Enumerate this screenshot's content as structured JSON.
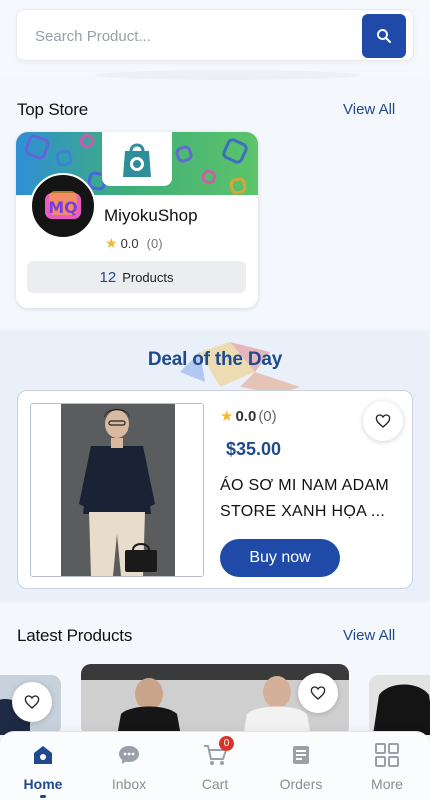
{
  "search": {
    "placeholder": "Search Product..."
  },
  "top_store": {
    "title": "Top Store",
    "view_all": "View All",
    "store": {
      "name": "MiyokuShop",
      "rating": "0.0",
      "review_count": "(0)",
      "product_count": "12",
      "products_label": "Products",
      "avatar_letters": "MQ"
    }
  },
  "deal": {
    "title": "Deal of the Day",
    "rating": "0.0",
    "review_count": "(0)",
    "price": "$35.00",
    "name": "ÁO SƠ MI NAM ADAM STORE XANH HỌA ...",
    "buy_label": "Buy now"
  },
  "latest": {
    "title": "Latest Products",
    "view_all": "View All"
  },
  "nav": {
    "items": [
      {
        "label": "Home",
        "icon": "home-icon",
        "active": true
      },
      {
        "label": "Inbox",
        "icon": "chat-icon"
      },
      {
        "label": "Cart",
        "icon": "cart-icon",
        "badge": "0"
      },
      {
        "label": "Orders",
        "icon": "orders-icon"
      },
      {
        "label": "More",
        "icon": "grid-icon"
      }
    ]
  },
  "colors": {
    "brand": "#1f4aa8",
    "accent_text": "#1f4a8e",
    "star": "#f5b82e",
    "badge": "#d9342b"
  }
}
